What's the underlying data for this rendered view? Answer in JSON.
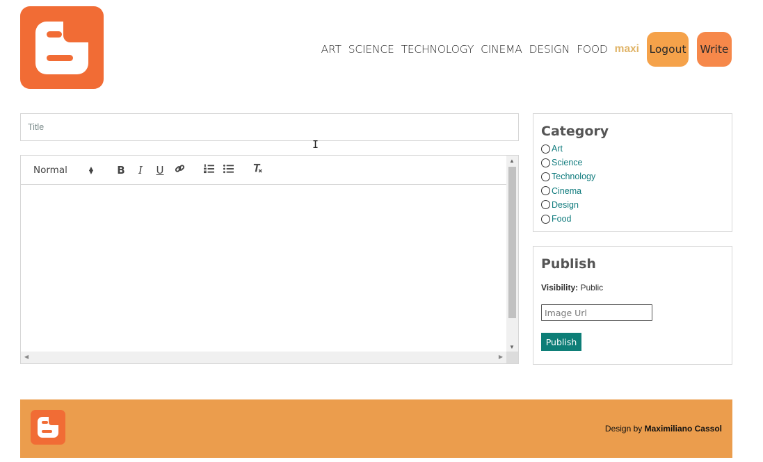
{
  "brand": {
    "logo_icon": "blogger-logo-icon",
    "logo_color": "#f16c35"
  },
  "nav": {
    "links": [
      "ART",
      "SCIENCE",
      "TECHNOLOGY",
      "CINEMA",
      "DESIGN",
      "FOOD"
    ],
    "username": "maxi",
    "logout_label": "Logout",
    "write_label": "Write"
  },
  "write": {
    "title_placeholder": "Title",
    "editor": {
      "format_select": "Normal",
      "toolbar_buttons": [
        "bold-icon",
        "italic-icon",
        "underline-icon",
        "link-icon",
        "ordered-list-icon",
        "bullet-list-icon",
        "clear-format-icon"
      ]
    }
  },
  "category": {
    "heading": "Category",
    "options": [
      "Art",
      "Science",
      "Technology",
      "Cinema",
      "Design",
      "Food"
    ]
  },
  "publish": {
    "heading": "Publish",
    "visibility_label": "Visibility:",
    "visibility_value": "Public",
    "image_placeholder": "Image Url",
    "button_label": "Publish",
    "button_color": "#0d7e77"
  },
  "footer": {
    "credit_prefix": "Design by",
    "credit_name": "Maximiliano Cassol",
    "background": "#eb9d4d"
  }
}
